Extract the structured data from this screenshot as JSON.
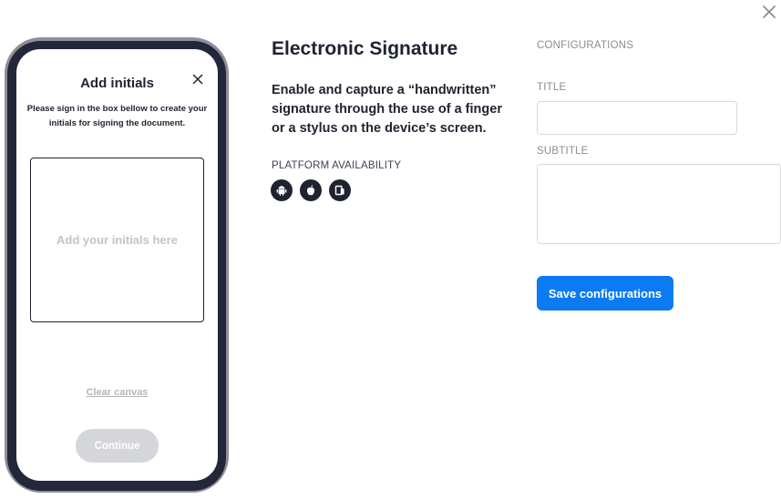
{
  "modal": {
    "close_icon": "close-icon"
  },
  "phone": {
    "title": "Add initials",
    "close_icon": "close-icon",
    "instructions_line1": "Please sign in the box bellow to create your",
    "instructions_line2": "initials for signing the document.",
    "canvas_placeholder": "Add your initials here",
    "clear_label": "Clear canvas",
    "continue_label": "Continue"
  },
  "feature": {
    "title": "Electronic Signature",
    "description_line1": "Enable and capture a “handwritten”",
    "description_line2": "signature through the use of a finger",
    "description_line3": "or a stylus on the device’s screen.",
    "platform_label": "PLATFORM AVAILABILITY",
    "platforms": [
      "android-icon",
      "apple-icon",
      "web-icon"
    ]
  },
  "config": {
    "heading": "CONFIGURATIONS",
    "title_label": "TITLE",
    "title_value": "",
    "subtitle_label": "SUBTITLE",
    "subtitle_value": "",
    "save_label": "Save configurations"
  },
  "colors": {
    "primary": "#0a7bf2",
    "dark": "#1f2330",
    "muted": "#8a8d96",
    "disabled": "#d5d6da"
  }
}
